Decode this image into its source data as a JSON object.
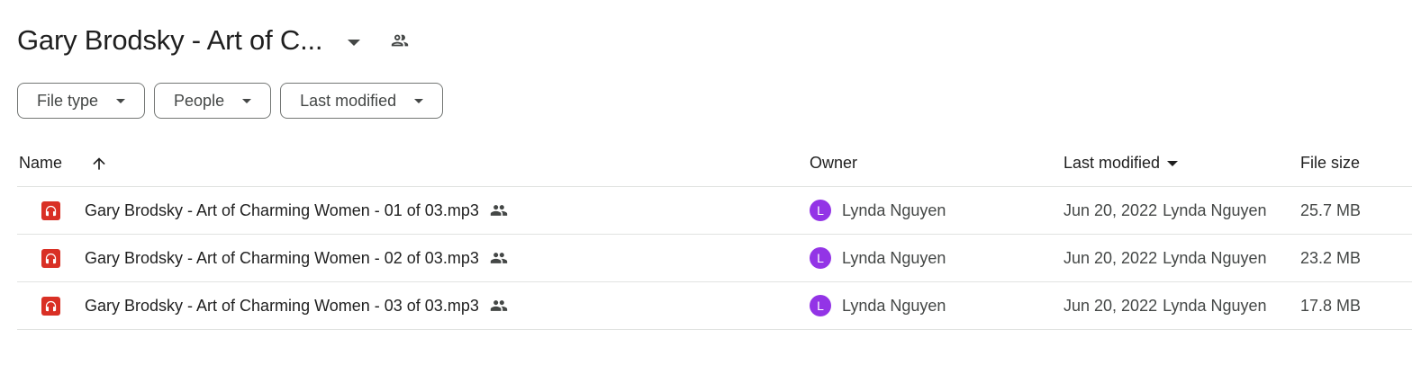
{
  "header": {
    "title": "Gary Brodsky - Art of C..."
  },
  "filters": [
    {
      "label": "File type"
    },
    {
      "label": "People"
    },
    {
      "label": "Last modified"
    }
  ],
  "columns": {
    "name": "Name",
    "owner": "Owner",
    "last_modified": "Last modified",
    "file_size": "File size"
  },
  "files": [
    {
      "name": "Gary Brodsky - Art of Charming Women - 01 of 03.mp3",
      "owner_initial": "L",
      "owner": "Lynda Nguyen",
      "date": "Jun 20, 2022",
      "modified_by": "Lynda Nguyen",
      "size": "25.7 MB"
    },
    {
      "name": "Gary Brodsky - Art of Charming Women - 02 of 03.mp3",
      "owner_initial": "L",
      "owner": "Lynda Nguyen",
      "date": "Jun 20, 2022",
      "modified_by": "Lynda Nguyen",
      "size": "23.2 MB"
    },
    {
      "name": "Gary Brodsky - Art of Charming Women - 03 of 03.mp3",
      "owner_initial": "L",
      "owner": "Lynda Nguyen",
      "date": "Jun 20, 2022",
      "modified_by": "Lynda Nguyen",
      "size": "17.8 MB"
    }
  ],
  "colors": {
    "file_icon": "#d93025",
    "avatar": "#9334e6"
  },
  "icons": {
    "shared": "people-icon",
    "file_type": "audio-file-icon",
    "sort": "arrow-up-icon"
  }
}
